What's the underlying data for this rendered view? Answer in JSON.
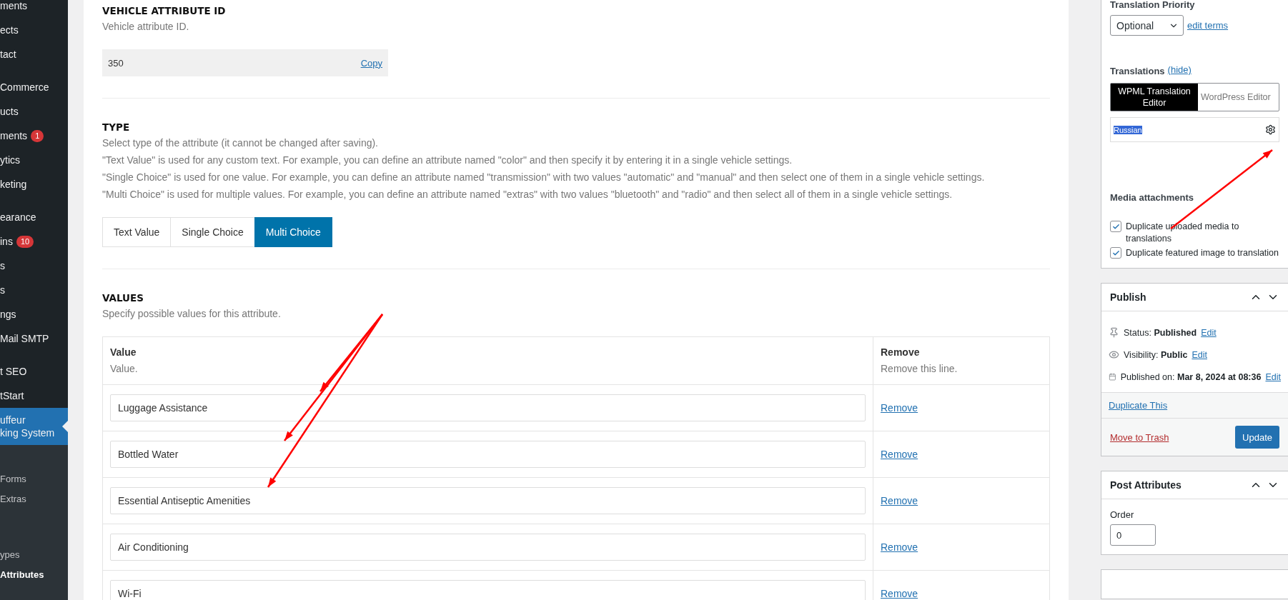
{
  "sidebar": {
    "sections": [
      {
        "items": [
          {
            "label": "ments",
            "selected": false
          },
          {
            "label": "ects",
            "selected": false
          },
          {
            "label": "tact",
            "selected": false
          }
        ]
      },
      {
        "items": [
          {
            "label": "Commerce",
            "selected": false
          },
          {
            "label": "ucts",
            "selected": false
          },
          {
            "label": "ments",
            "badge": "1",
            "selected": false
          },
          {
            "label": "ytics",
            "selected": false
          },
          {
            "label": "keting",
            "selected": false
          }
        ]
      },
      {
        "items": [
          {
            "label": "earance",
            "selected": false
          },
          {
            "label": "ins",
            "badge": "10",
            "selected": false
          },
          {
            "label": "s",
            "selected": false
          },
          {
            "label": "s",
            "selected": false
          },
          {
            "label": "ngs",
            "selected": false
          },
          {
            "label": "Mail SMTP",
            "selected": false
          }
        ]
      },
      {
        "items": [
          {
            "label": "t SEO",
            "selected": false
          },
          {
            "label": "tStart",
            "selected": false
          },
          {
            "label": "uffeur\nking System",
            "selected": true
          }
        ]
      }
    ],
    "submenu": [
      {
        "items": [
          {
            "label": "Forms",
            "selected": false
          },
          {
            "label": "Extras",
            "selected": false
          }
        ]
      },
      {
        "items": [
          {
            "label": "ypes",
            "selected": false
          },
          {
            "label": "Attributes",
            "selected": true
          }
        ]
      }
    ]
  },
  "id_section": {
    "title": "VEHICLE ATTRIBUTE ID",
    "description": "Vehicle attribute ID.",
    "value": "350",
    "copy_link": "Copy"
  },
  "type_section": {
    "title": "TYPE",
    "description": [
      "Select type of the attribute (it cannot be changed after saving).",
      "\"Text Value\" is used for any custom text. For example, you can define an attribute named \"color\" and then specify it by entering it in a single vehicle settings.",
      "\"Single Choice\" is used for one value. For example, you can define an attribute named \"transmission\" with two values \"automatic\" and \"manual\" and then select one of them in a single vehicle settings.",
      "\"Multi Choice\" is used for multiple values. For example, you can define an attribute named \"extras\" with two values \"bluetooth\" and \"radio\" and then select all of them in a single vehicle settings."
    ],
    "options": [
      {
        "label": "Text Value",
        "selected": false
      },
      {
        "label": "Single Choice",
        "selected": false
      },
      {
        "label": "Multi Choice",
        "selected": true
      }
    ]
  },
  "values_section": {
    "title": "VALUES",
    "description": "Specify possible values for this attribute.",
    "columns": [
      {
        "title": "Value",
        "description": "Value."
      },
      {
        "title": "Remove",
        "description": "Remove this line."
      }
    ],
    "rows": [
      {
        "value": "Luggage Assistance",
        "remove": "Remove"
      },
      {
        "value": "Bottled Water",
        "remove": "Remove"
      },
      {
        "value": "Essential Antiseptic Amenities",
        "remove": "Remove"
      },
      {
        "value": "Air Conditioning",
        "remove": "Remove"
      },
      {
        "value": "Wi-Fi",
        "remove": "Remove"
      }
    ]
  },
  "language_box": {
    "priority_label": "Translation Priority",
    "priority_value": "Optional",
    "edit_terms": "edit terms",
    "translations_label": "Translations",
    "hide_link": "(hide)",
    "editor_tabs": [
      {
        "label": "WPML Translation Editor",
        "selected": true
      },
      {
        "label": "WordPress Editor",
        "selected": false
      }
    ],
    "language": "Russian",
    "media_label": "Media attachments",
    "media_options": [
      {
        "label": "Duplicate uploaded media to translations",
        "checked": true
      },
      {
        "label": "Duplicate featured image to translation",
        "checked": true
      }
    ]
  },
  "publish_box": {
    "title": "Publish",
    "rows": [
      {
        "kind": "status",
        "label": "Status:",
        "value": "Published",
        "link": "Edit"
      },
      {
        "kind": "visibility",
        "label": "Visibility:",
        "value": "Public",
        "link": "Edit"
      },
      {
        "kind": "date",
        "label": "Published on:",
        "value": "Mar 8, 2024 at 08:36",
        "link": "Edit"
      }
    ],
    "duplicate_link": "Duplicate This",
    "trash_link": "Move to Trash",
    "update_button": "Update"
  },
  "attributes_box": {
    "title": "Post Attributes",
    "order_label": "Order",
    "order_value": "0"
  }
}
